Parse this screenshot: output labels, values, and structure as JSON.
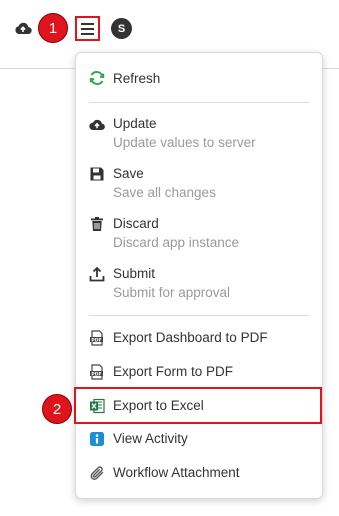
{
  "topbar": {
    "step1_label": "1",
    "avatar_initial": "S",
    "icons": [
      "cloud-upload-icon",
      "hamburger-menu-icon"
    ]
  },
  "menu": {
    "refresh": {
      "label": "Refresh",
      "icon": "refresh-icon"
    },
    "update": {
      "label": "Update",
      "sub": "Update values to server",
      "icon": "cloud-upload-icon"
    },
    "save": {
      "label": "Save",
      "sub": "Save all changes",
      "icon": "floppy-disk-icon"
    },
    "discard": {
      "label": "Discard",
      "sub": "Discard app instance",
      "icon": "trash-icon"
    },
    "submit": {
      "label": "Submit",
      "sub": "Submit for approval",
      "icon": "upload-icon"
    },
    "export_dashboard_pdf": {
      "label": "Export Dashboard to PDF",
      "icon": "pdf-icon"
    },
    "export_form_pdf": {
      "label": "Export Form to PDF",
      "icon": "pdf-icon"
    },
    "export_excel": {
      "label": "Export to Excel",
      "icon": "excel-icon"
    },
    "view_activity": {
      "label": "View Activity",
      "icon": "info-icon"
    },
    "workflow_attachment": {
      "label": "Workflow Attachment",
      "icon": "paperclip-icon"
    }
  },
  "step2_label": "2",
  "colors": {
    "highlight": "#e0141c",
    "refresh_green": "#2fa84f",
    "excel_green": "#1d7a3e",
    "info_blue": "#1a8fd6"
  }
}
